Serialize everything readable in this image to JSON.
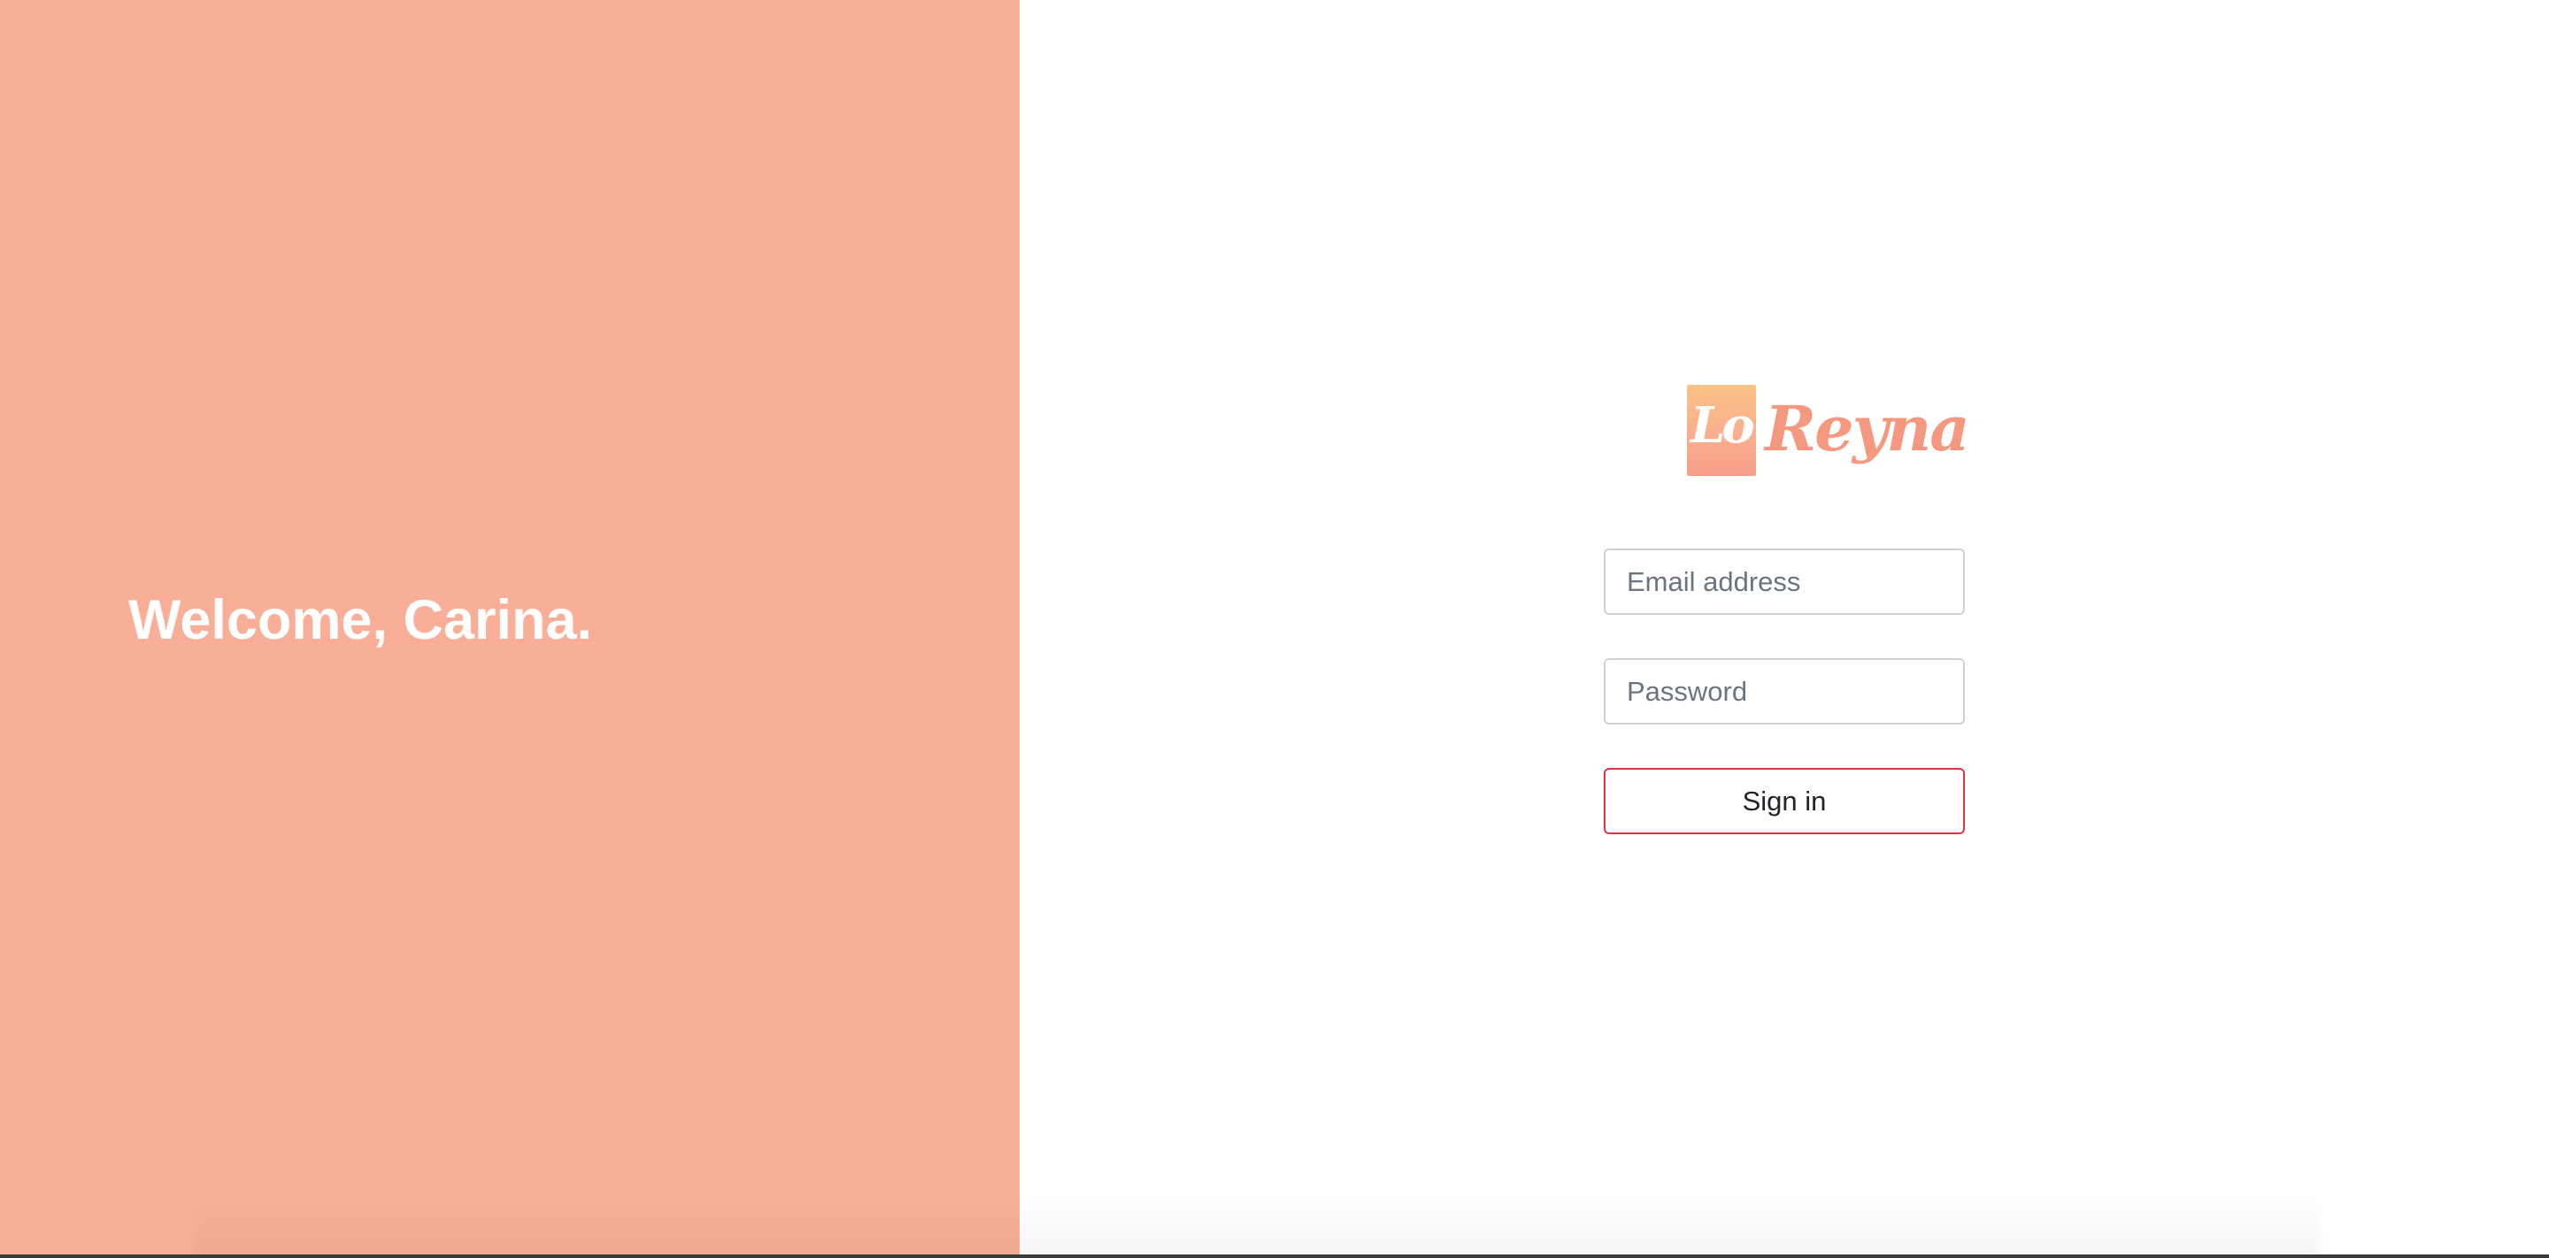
{
  "colors": {
    "left_panel_bg": "#f9af97",
    "right_panel_bg": "#ffffff",
    "button_border": "#dc3545",
    "logo_text": "#f49980"
  },
  "left_panel": {
    "welcome_text": "Welcome, Carina."
  },
  "logo": {
    "mark_text": "Lo",
    "wordmark": "Reyna"
  },
  "login_form": {
    "email_placeholder": "Email address",
    "email_value": "",
    "password_placeholder": "Password",
    "password_value": "",
    "signin_label": "Sign in"
  }
}
